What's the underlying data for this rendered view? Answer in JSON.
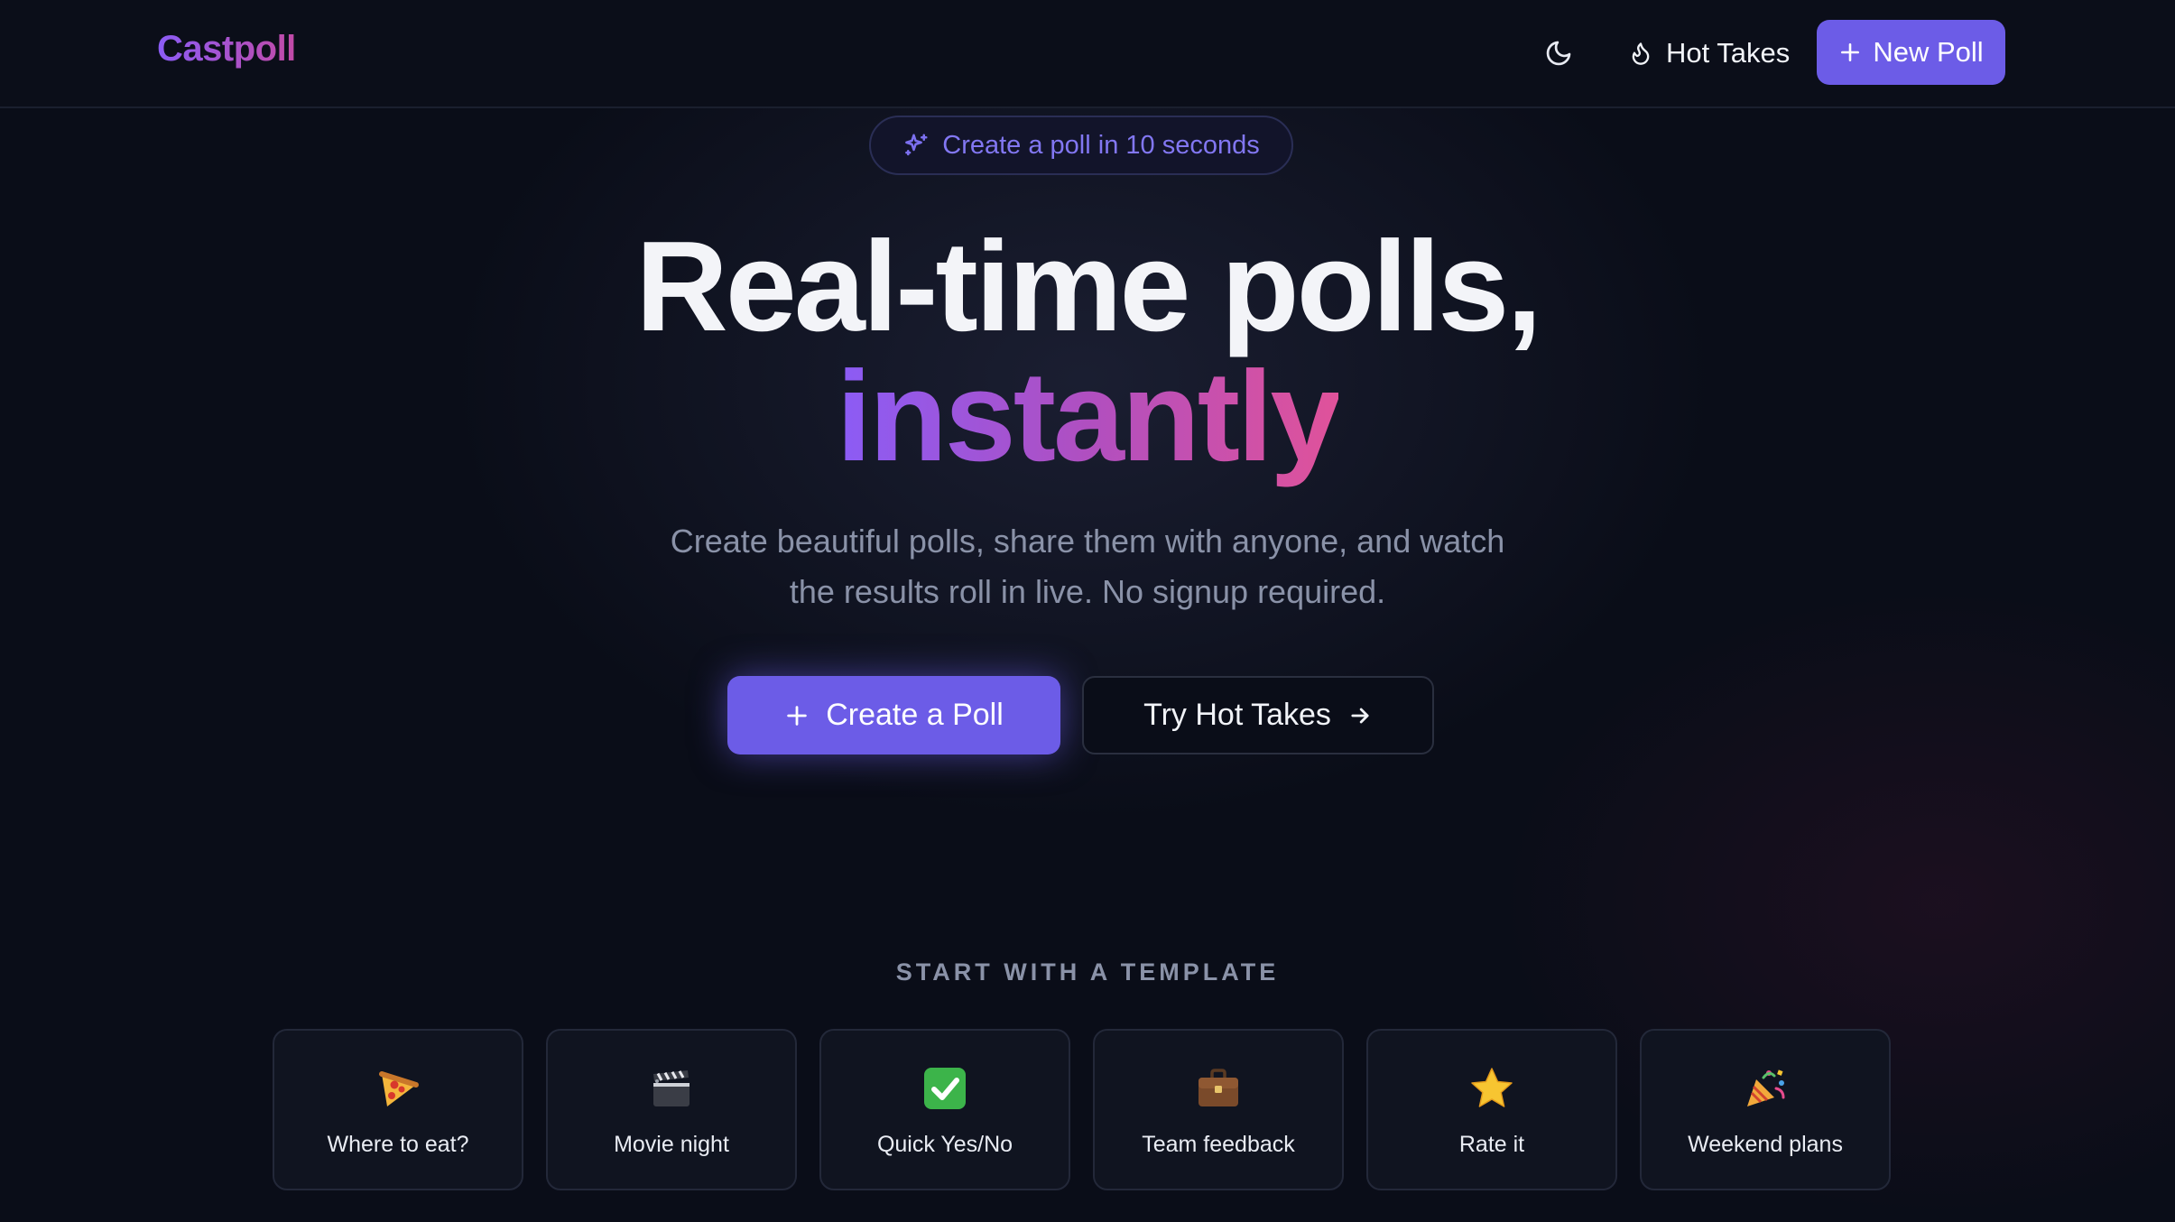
{
  "header": {
    "brand": "Castpoll",
    "theme_toggle_icon": "moon-icon",
    "hot_takes_label": "Hot Takes",
    "hot_takes_icon": "flame-icon",
    "new_poll_label": "New Poll",
    "new_poll_icon": "plus-icon"
  },
  "hero": {
    "pill_text": "Create a poll in 10 seconds",
    "pill_icon": "sparkles-icon",
    "headline_line1": "Real-time polls,",
    "headline_line2": "instantly",
    "subtitle_line1": "Create beautiful polls, share them with anyone, and watch",
    "subtitle_line2": "the results roll in live. No signup required.",
    "primary_cta": "Create a Poll",
    "secondary_cta": "Try Hot Takes"
  },
  "templates": {
    "heading": "START WITH A TEMPLATE",
    "items": [
      {
        "label": "Where to eat?",
        "icon": "pizza-icon"
      },
      {
        "label": "Movie night",
        "icon": "clapperboard-icon"
      },
      {
        "label": "Quick Yes/No",
        "icon": "check-mark-icon"
      },
      {
        "label": "Team feedback",
        "icon": "briefcase-icon"
      },
      {
        "label": "Rate it",
        "icon": "star-icon"
      },
      {
        "label": "Weekend plans",
        "icon": "party-popper-icon"
      }
    ]
  },
  "colors": {
    "background": "#0a0d18",
    "accent": "#6c5ce7",
    "gradient_start": "#8b5cf6",
    "gradient_end": "#e0529a",
    "muted_text": "#8a92a8"
  }
}
